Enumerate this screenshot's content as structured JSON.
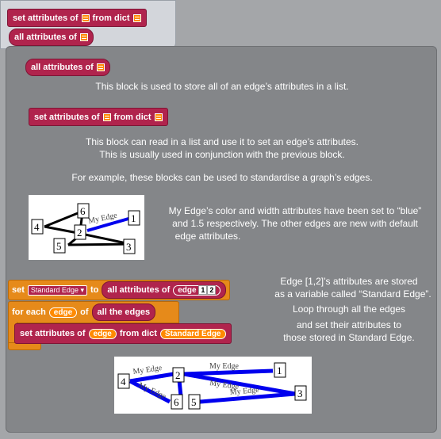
{
  "palette": {
    "set_attrs": {
      "w1": "set attributes of",
      "w2": "from dict"
    },
    "all_attrs": "all attributes of"
  },
  "sections": {
    "all_block": "all attributes of",
    "all_desc": "This block is used to store all of an edge’s attributes in a list.",
    "set_block": {
      "w1": "set attributes of",
      "w2": "from dict"
    },
    "set_desc_1": "This block can read in a list and use it to set an edge’s attributes.",
    "set_desc_2": "This is usually used in conjunction with the previous block.",
    "example": "For example, these blocks can be used to standardise a graph’s edges.",
    "img1_desc_1": "My Edge’s color and width attributes have been set to “blue”",
    "img1_desc_2": "and 1.5 respectively. The other edges are new with default",
    "img1_desc_3": "edge attributes.",
    "img1_label": "My Edge",
    "right_desc_1": "Edge [1,2]’s attributes are stored",
    "right_desc_2": "as a variable called “Standard Edge”.",
    "right_desc_3": "Loop through all the edges",
    "right_desc_4": "and set their attributes to",
    "right_desc_5": "those stored in Standard Edge."
  },
  "script": {
    "set": "set",
    "var": "Standard Edge",
    "to": "to",
    "all_attrs": "all attributes of",
    "edge": "edge",
    "n1": "1",
    "n2": "2",
    "for_each": "for each",
    "item": "edge",
    "of": "of",
    "all_edges": "all the edges",
    "set_attrs": "set attributes of",
    "from_dict": "from dict",
    "std": "Standard Edge"
  },
  "graph1": {
    "nodes": [
      "4",
      "6",
      "2",
      "1",
      "5",
      "3"
    ],
    "edge_label": "My Edge"
  },
  "graph2": {
    "nodes": [
      "4",
      "2",
      "1",
      "6",
      "5",
      "3"
    ],
    "edge_label": "My Edge"
  }
}
